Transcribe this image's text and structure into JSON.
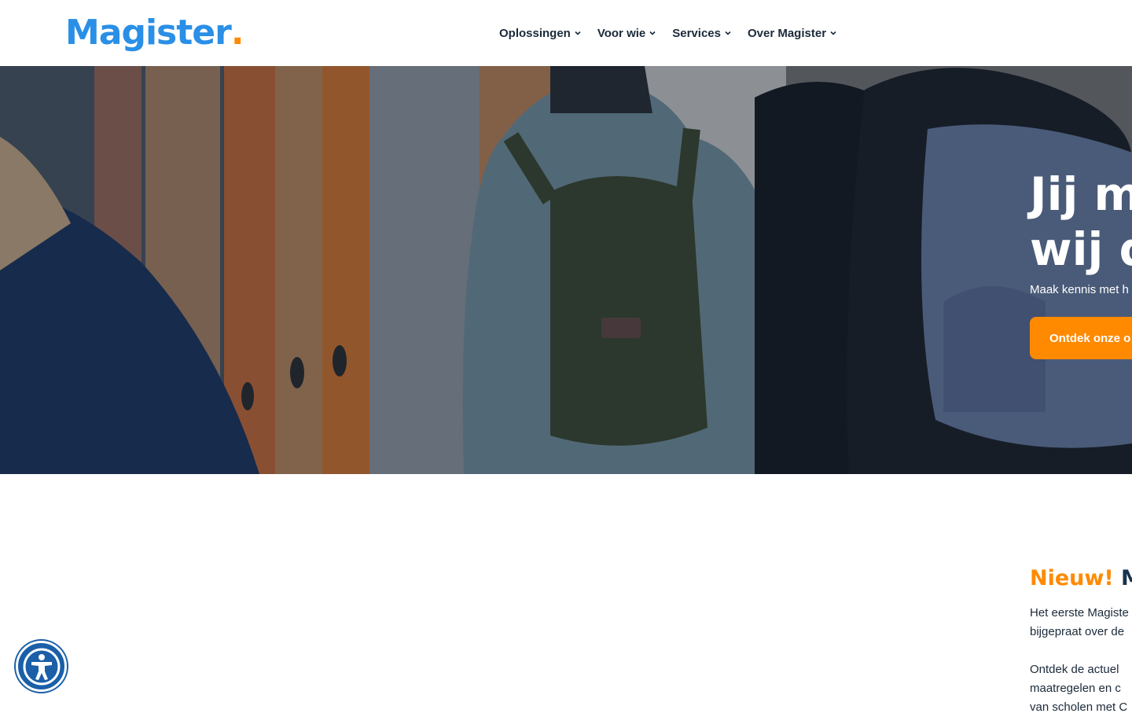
{
  "brand": {
    "name": "Magister",
    "dot": ".",
    "accent": "#ff8a00",
    "primary": "#2a8fe6"
  },
  "nav": {
    "items": [
      {
        "label": "Oplossingen",
        "icon": "chevron-down-icon"
      },
      {
        "label": "Voor wie",
        "icon": "chevron-down-icon"
      },
      {
        "label": "Services",
        "icon": "chevron-down-icon"
      },
      {
        "label": "Over Magister",
        "icon": "chevron-down-icon"
      }
    ]
  },
  "hero": {
    "title_line1": "Jij m",
    "title_line2": "wij d",
    "subtitle": "Maak kennis met h",
    "cta_label": "Ontdek onze o"
  },
  "news": {
    "new_label": "Nieuw!",
    "heading_rest": " Ma",
    "p1_line1": "Het eerste Magiste",
    "p1_line2": "bijgepraat over de",
    "p2_line1": "Ontdek de actuel",
    "p2_line2": "maatregelen en c",
    "p2_line3": "van scholen met C"
  },
  "accessibility": {
    "icon": "accessibility-icon"
  }
}
